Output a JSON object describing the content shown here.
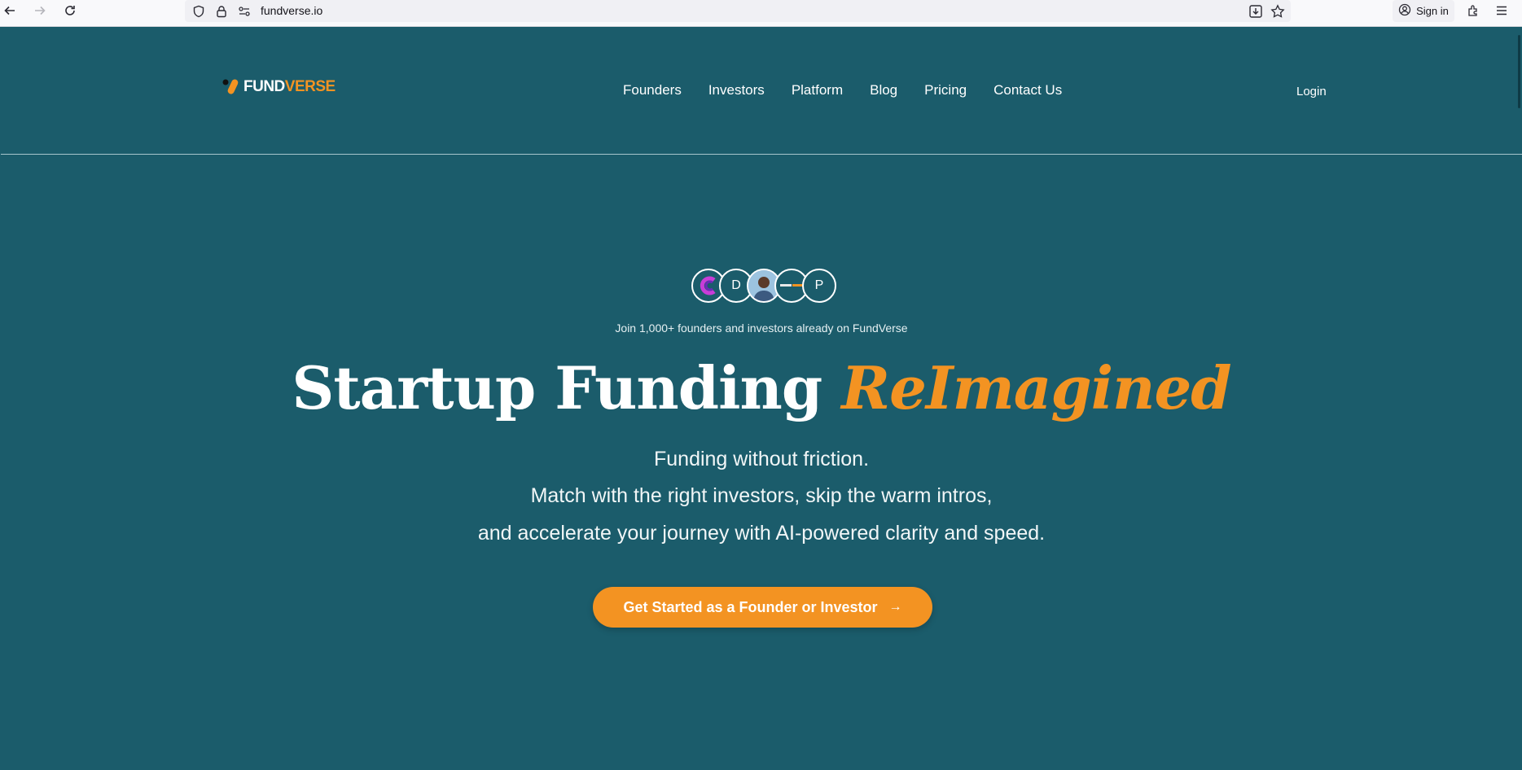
{
  "browser": {
    "url": "fundverse.io",
    "sign_in_label": "Sign in",
    "icons": [
      "back-icon",
      "forward-icon",
      "reload-icon",
      "shield-icon",
      "lock-icon",
      "site-settings-icon",
      "save-to-pocket-icon",
      "bookmark-star-icon",
      "account-icon",
      "extensions-icon",
      "menu-icon"
    ]
  },
  "header": {
    "logo": {
      "fund": "FUND",
      "verse": "VERSE"
    },
    "nav": [
      "Founders",
      "Investors",
      "Platform",
      "Blog",
      "Pricing",
      "Contact Us"
    ],
    "login_label": "Login"
  },
  "hero": {
    "avatars": [
      {
        "type": "logo",
        "label": "C"
      },
      {
        "type": "initial",
        "label": "D"
      },
      {
        "type": "photo",
        "label": ""
      },
      {
        "type": "logo",
        "label": ""
      },
      {
        "type": "initial",
        "label": "P"
      }
    ],
    "join_text": "Join 1,000+ founders and investors already on FundVerse",
    "title_main": "Startup Funding",
    "title_accent": "ReImagined",
    "subtitle_lines": [
      "Funding without friction.",
      "Match with the right investors, skip the warm intros,",
      "and accelerate your journey with AI-powered clarity and speed."
    ],
    "cta_label": "Get Started as a Founder or Investor",
    "cta_arrow": "→"
  },
  "colors": {
    "background": "#1b5c6b",
    "accent": "#f39322",
    "text": "#ffffff"
  }
}
